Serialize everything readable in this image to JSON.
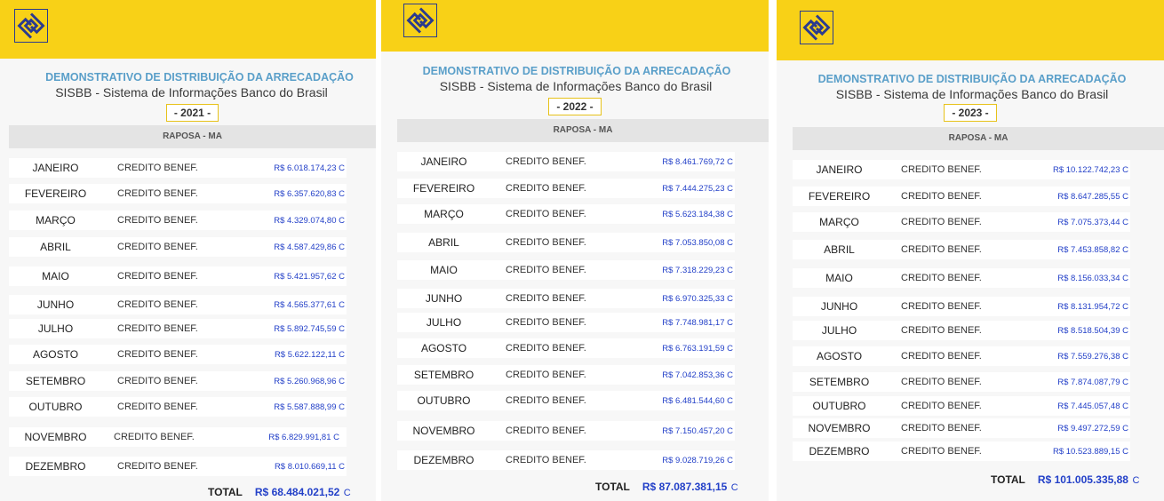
{
  "panels": [
    {
      "title": "DEMONSTRATIVO DE DISTRIBUIÇÃO DA ARRECADAÇÃO",
      "subtitle": "SISBB - Sistema de Informações Banco do Brasil",
      "year": "- 2021 -",
      "region": "RAPOSA - MA",
      "rows": [
        {
          "month": "JANEIRO",
          "desc": "CREDITO BENEF.",
          "value": "R$ 6.018.174,23 C"
        },
        {
          "month": "FEVEREIRO",
          "desc": "CREDITO BENEF.",
          "value": "R$ 6.357.620,83 C"
        },
        {
          "month": "MARÇO",
          "desc": "CREDITO BENEF.",
          "value": "R$ 4.329.074,80 C"
        },
        {
          "month": "ABRIL",
          "desc": "CREDITO BENEF.",
          "value": "R$ 4.587.429,86 C"
        },
        {
          "month": "MAIO",
          "desc": "CREDITO BENEF.",
          "value": "R$ 5.421.957,62 C"
        },
        {
          "month": "JUNHO",
          "desc": "CREDITO BENEF.",
          "value": "R$ 4.565.377,61 C"
        },
        {
          "month": "JULHO",
          "desc": "CREDITO BENEF.",
          "value": "R$ 5.892.745,59 C"
        },
        {
          "month": "AGOSTO",
          "desc": "CREDITO BENEF.",
          "value": "R$ 5.622.122,11 C"
        },
        {
          "month": "SETEMBRO",
          "desc": "CREDITO BENEF.",
          "value": "R$ 5.260.968,96 C"
        },
        {
          "month": "OUTUBRO",
          "desc": "CREDITO BENEF.",
          "value": "R$ 5.587.888,99 C"
        },
        {
          "month": "NOVEMBRO",
          "desc": "CREDITO BENEF.",
          "value": "R$ 6.829.991,81 C"
        },
        {
          "month": "DEZEMBRO",
          "desc": "CREDITO BENEF.",
          "value": "R$ 8.010.669,11 C"
        }
      ],
      "total_label": "TOTAL",
      "total_value": "R$ 68.484.021,52",
      "total_suffix": "C"
    },
    {
      "title": "DEMONSTRATIVO DE DISTRIBUIÇÃO DA ARRECADAÇÃO",
      "subtitle": "SISBB - Sistema de Informações Banco do Brasil",
      "year": "- 2022 -",
      "region": "RAPOSA - MA",
      "rows": [
        {
          "month": "JANEIRO",
          "desc": "CREDITO BENEF.",
          "value": "R$ 8.461.769,72 C"
        },
        {
          "month": "FEVEREIRO",
          "desc": "CREDITO BENEF.",
          "value": "R$ 7.444.275,23 C"
        },
        {
          "month": "MARÇO",
          "desc": "CREDITO BENEF.",
          "value": "R$ 5.623.184,38 C"
        },
        {
          "month": "ABRIL",
          "desc": "CREDITO BENEF.",
          "value": "R$ 7.053.850,08 C"
        },
        {
          "month": "MAIO",
          "desc": "CREDITO BENEF.",
          "value": "R$ 7.318.229,23 C"
        },
        {
          "month": "JUNHO",
          "desc": "CREDITO BENEF.",
          "value": "R$ 6.970.325,33 C"
        },
        {
          "month": "JULHO",
          "desc": "CREDITO BENEF.",
          "value": "R$ 7.748.981,17 C"
        },
        {
          "month": "AGOSTO",
          "desc": "CREDITO BENEF.",
          "value": "R$ 6.763.191,59 C"
        },
        {
          "month": "SETEMBRO",
          "desc": "CREDITO BENEF.",
          "value": "R$ 7.042.853,36 C"
        },
        {
          "month": "OUTUBRO",
          "desc": "CREDITO BENEF.",
          "value": "R$ 6.481.544,60 C"
        },
        {
          "month": "NOVEMBRO",
          "desc": "CREDITO BENEF.",
          "value": "R$ 7.150.457,20 C"
        },
        {
          "month": "DEZEMBRO",
          "desc": "CREDITO BENEF.",
          "value": "R$ 9.028.719,26 C"
        }
      ],
      "total_label": "TOTAL",
      "total_value": "R$ 87.087.381,15",
      "total_suffix": "C"
    },
    {
      "title": "DEMONSTRATIVO DE DISTRIBUIÇÃO DA ARRECADAÇÃO",
      "subtitle": "SISBB - Sistema de Informações Banco do Brasil",
      "year": "- 2023 -",
      "region": "RAPOSA - MA",
      "rows": [
        {
          "month": "JANEIRO",
          "desc": "CREDITO BENEF.",
          "value": "R$ 10.122.742,23 C"
        },
        {
          "month": "FEVEREIRO",
          "desc": "CREDITO BENEF.",
          "value": "R$ 8.647.285,55 C"
        },
        {
          "month": "MARÇO",
          "desc": "CREDITO BENEF.",
          "value": "R$ 7.075.373,44 C"
        },
        {
          "month": "ABRIL",
          "desc": "CREDITO BENEF.",
          "value": "R$ 7.453.858,82 C"
        },
        {
          "month": "MAIO",
          "desc": "CREDITO BENEF.",
          "value": "R$ 8.156.033,34 C"
        },
        {
          "month": "JUNHO",
          "desc": "CREDITO BENEF.",
          "value": "R$ 8.131.954,72 C"
        },
        {
          "month": "JULHO",
          "desc": "CREDITO BENEF.",
          "value": "R$ 8.518.504,39 C"
        },
        {
          "month": "AGOSTO",
          "desc": "CREDITO BENEF.",
          "value": "R$ 7.559.276,38 C"
        },
        {
          "month": "SETEMBRO",
          "desc": "CREDITO BENEF.",
          "value": "R$ 7.874.087,79 C"
        },
        {
          "month": "OUTUBRO",
          "desc": "CREDITO BENEF.",
          "value": "R$ 7.445.057,48 C"
        },
        {
          "month": "NOVEMBRO",
          "desc": "CREDITO BENEF.",
          "value": "R$ 9.497.272,59 C"
        },
        {
          "month": "DEZEMBRO",
          "desc": "CREDITO BENEF.",
          "value": "R$ 10.523.889,15 C"
        }
      ],
      "total_label": "TOTAL",
      "total_value": "R$ 101.005.335,88",
      "total_suffix": "C"
    }
  ],
  "icons": {
    "logo": "banco-do-brasil-logo-icon"
  },
  "colors": {
    "brand_yellow": "#f8d117",
    "brand_blue": "#2b3b8f",
    "title_blue": "#5a9fc9",
    "value_blue": "#2340c8"
  }
}
